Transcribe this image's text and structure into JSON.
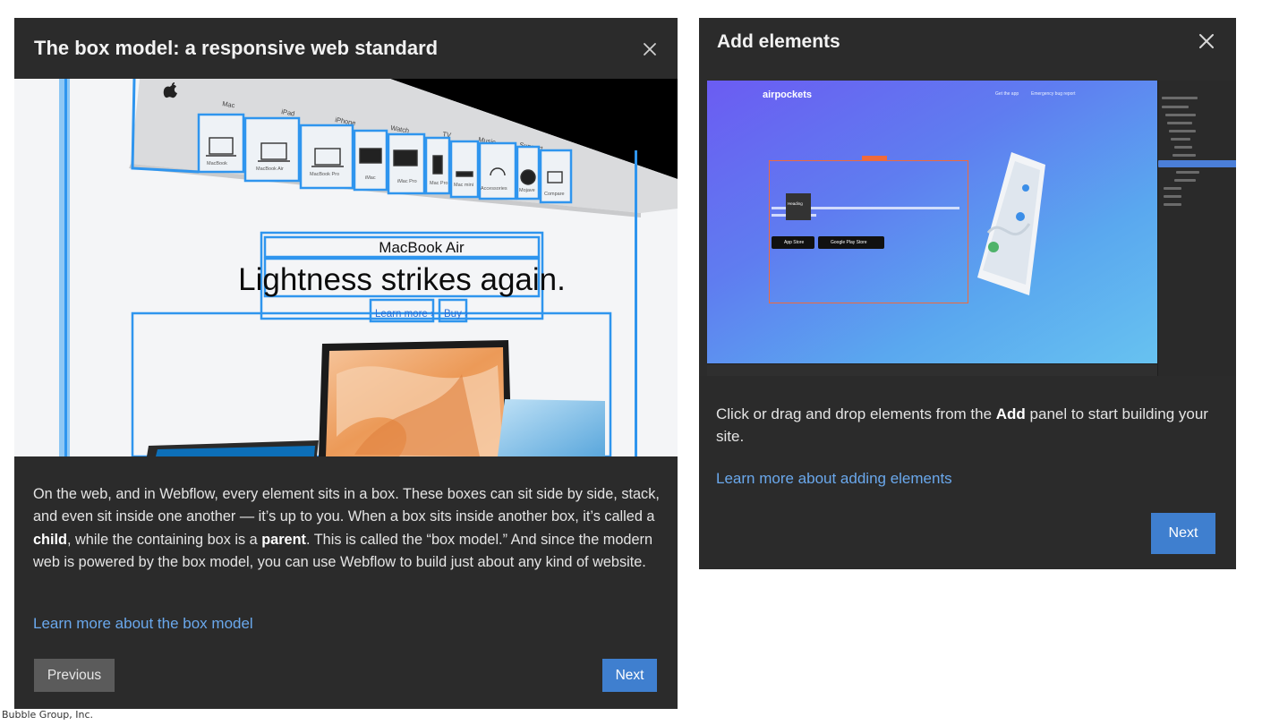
{
  "left_modal": {
    "title": "The box model: a responsive web standard",
    "illustration": {
      "nav_items": [
        "Mac",
        "iPad",
        "iPhone",
        "Watch",
        "TV",
        "Music",
        "Support"
      ],
      "product_tiles": [
        "MacBook",
        "MacBook Air",
        "MacBook Pro",
        "iMac",
        "iMac Pro",
        "Mac Pro",
        "Mac mini",
        "Accessories",
        "Mojave",
        "Compare"
      ],
      "eyebrow": "MacBook Air",
      "headline": "Lightness strikes again.",
      "link_learn_more": "Learn more ›",
      "link_buy": "Buy ›"
    },
    "body": {
      "p1": "On the web, and in Webflow, every element sits in a box. These boxes can sit side by side, stack, and even sit inside one another — it’s up to you. When a box sits inside another box, it’s called a ",
      "b1": "child",
      "p2": ", while the containing box is a ",
      "b2": "parent",
      "p3": ". This is called the “box model.” And since the modern web is powered by the box model, you can use Webflow to build just about any kind of website."
    },
    "link": "Learn more about the box model",
    "previous_label": "Previous",
    "next_label": "Next"
  },
  "right_modal": {
    "title": "Add elements",
    "illustration": {
      "brand": "airpockets",
      "nav_1": "Get the app",
      "nav_2": "Emergency bug report",
      "tooltip": "Heading",
      "app_store": "App Store",
      "google_play": "Google Play Store"
    },
    "body": {
      "p1": "Click or drag and drop elements from the ",
      "b1": "Add",
      "p2": " panel to start building your site."
    },
    "link": "Learn more about adding elements",
    "next_label": "Next"
  },
  "footer": {
    "credit": "Bubble Group, Inc."
  },
  "colors": {
    "modal_bg": "#2b2b2b",
    "primary": "#3f7fcf",
    "link": "#6aa8ec",
    "box_outline": "#3aa0f2"
  },
  "icons": {
    "close": "close-icon",
    "apple": "apple-logo-icon"
  }
}
